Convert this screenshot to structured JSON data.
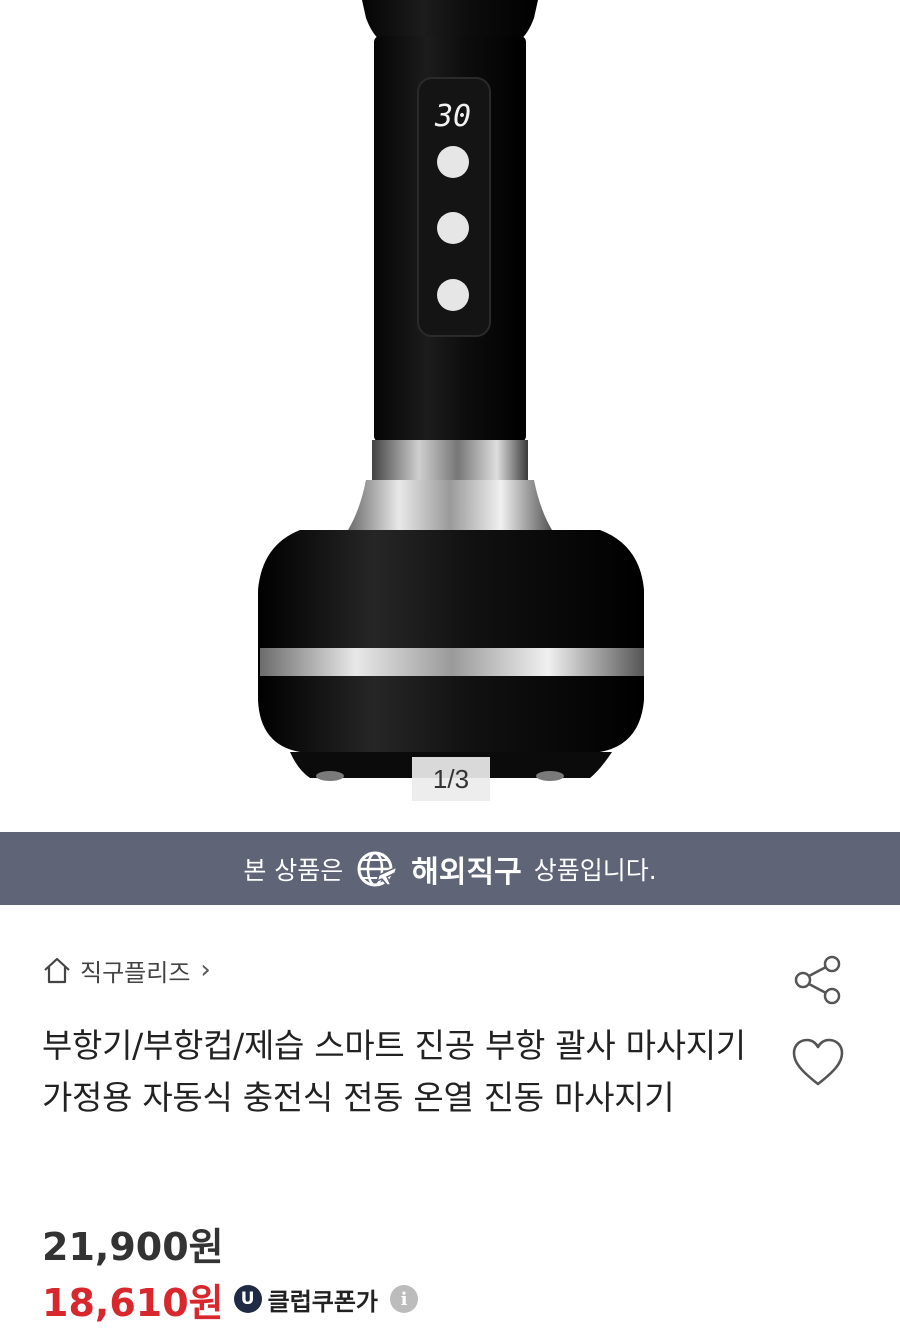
{
  "gallery": {
    "display_value": "30",
    "counter": "1/3"
  },
  "banner": {
    "prefix": "본 상품은",
    "brand": "해외직구",
    "suffix": "상품입니다."
  },
  "store": {
    "name": "직구플리즈",
    "chevron": "›"
  },
  "product": {
    "title": "부항기/부항컵/제습 스마트 진공 부항 괄사 마사지기 가정용 자동식 충전식 전동 온열 진동 마사지기",
    "price": "21,900원",
    "sale_price": "18,610원",
    "coupon_badge": "U",
    "coupon_label": "클럽쿠폰가",
    "info_glyph": "i"
  },
  "colors": {
    "banner_bg": "#5f6577",
    "sale_red": "#d9272e"
  }
}
